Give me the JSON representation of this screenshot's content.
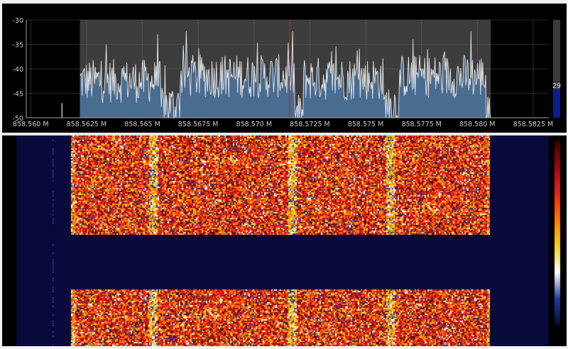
{
  "chart_data": [
    {
      "type": "area",
      "role": "spectrum",
      "x_tick_labels": [
        "858.560 M",
        "858.5625 M",
        "858.565 M",
        "858.5675 M",
        "858.570 M",
        "858.5725 M",
        "858.575 M",
        "858.5775 M",
        "858.580 M",
        "858.5825 M"
      ],
      "x_ticks": [
        858.56,
        858.5625,
        858.565,
        858.5675,
        858.57,
        858.5725,
        858.575,
        858.5775,
        858.58,
        858.5825
      ],
      "xlim": [
        858.5598,
        858.5832
      ],
      "y_tick_labels": [
        "-30",
        "-35",
        "-40",
        "-45",
        "-50"
      ],
      "y_ticks": [
        -30,
        -35,
        -40,
        -45,
        -50
      ],
      "ylim": [
        -50,
        -30
      ],
      "passband": [
        858.5622,
        858.5806
      ],
      "center_marker": 858.5716,
      "noise_spike": {
        "x": 858.5614,
        "y": -47
      },
      "segments": [
        {
          "x": [
            858.5622,
            858.5658
          ],
          "mean_level": -42.5
        },
        {
          "x": [
            858.5658,
            858.5667
          ],
          "mean_level": -47.5
        },
        {
          "x": [
            858.5667,
            858.5718
          ],
          "mean_level": -41.5
        },
        {
          "x": [
            858.5718,
            858.5722
          ],
          "mean_level": -49.5
        },
        {
          "x": [
            858.5722,
            858.5758
          ],
          "mean_level": -42
        },
        {
          "x": [
            858.5758,
            858.5765
          ],
          "mean_level": -47.5
        },
        {
          "x": [
            858.5765,
            858.5804
          ],
          "mean_level": -41.5
        }
      ],
      "peak_level": -32.3,
      "level_indicator": {
        "value": "29",
        "fraction": 0.29
      },
      "grid": true,
      "colors": {
        "background": "#000000",
        "passband": "#3d3d3d",
        "fill": "#4a6f96",
        "trace": "#e6e6e6",
        "grid": "#6e6e6e",
        "marker": "#c22020",
        "level_bar": "#0b1f8f",
        "ticks": "#c8c8c8"
      }
    },
    {
      "type": "heatmap",
      "role": "waterfall",
      "xlim": [
        858.5598,
        858.5832
      ],
      "signal_bursts": [
        {
          "x": [
            858.5622,
            858.5806
          ],
          "rows": [
            0,
            0.47
          ]
        },
        {
          "x": [
            858.5622,
            858.5806
          ],
          "rows": [
            0.73,
            1
          ]
        }
      ],
      "quiet_columns": [
        858.5658,
        858.5719,
        858.5762
      ],
      "colormap": [
        "#070a3a",
        "#1a3fa0",
        "#ffffff",
        "#f0d020",
        "#ff7a00",
        "#e8241c",
        "#a00a12",
        "#3d0000"
      ],
      "background": "#070a3a"
    }
  ]
}
